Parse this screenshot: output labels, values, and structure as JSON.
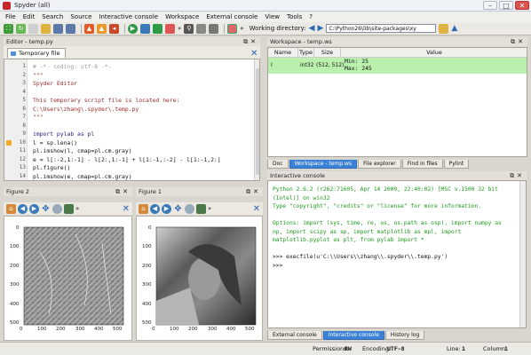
{
  "window": {
    "title": "Spyder (all)",
    "minimize": "–",
    "maximize": "□",
    "close": "✕"
  },
  "menu": [
    "File",
    "Edit",
    "Search",
    "Source",
    "Interactive console",
    "Workspace",
    "External console",
    "View",
    "Tools",
    "?"
  ],
  "toolbar": {
    "working_directory_label": "Working directory:",
    "working_directory_value": "C:\\Python26\\lib\\site-packages\\xy",
    "more": "»"
  },
  "editor": {
    "dock_title": "Editor - temp.py",
    "tab_label": "Temporary file",
    "lines": [
      {
        "n": "1",
        "text": "# -*- coding: utf-8 -*-",
        "color": "#9a9a9a"
      },
      {
        "n": "2",
        "text": "\"\"\"",
        "color": "#9a2a2a"
      },
      {
        "n": "3",
        "text": "Spyder Editor",
        "color": "#9a2a2a"
      },
      {
        "n": "4",
        "text": "",
        "color": "#000000"
      },
      {
        "n": "5",
        "text": "This temporary script file is located here:",
        "color": "#9a2a2a"
      },
      {
        "n": "6",
        "text": "C:\\Users\\zhang\\.spyder\\.temp.py",
        "color": "#9a2a2a"
      },
      {
        "n": "7",
        "text": "\"\"\"",
        "color": "#9a2a2a"
      },
      {
        "n": "8",
        "text": "",
        "color": "#000000"
      },
      {
        "n": "9",
        "text": "import pylab as pl",
        "color": "#1a1a80"
      },
      {
        "n": "10",
        "text": "l = sp.lena()",
        "color": "#111111"
      },
      {
        "n": "11",
        "text": "pl.imshow(l, cmap=pl.cm.gray)",
        "color": "#111111"
      },
      {
        "n": "12",
        "text": "e = l[:-2,1:-1] - l[2:,1:-1] + l[1:-1,:-2] - l[1:-1,2:]",
        "color": "#111111"
      },
      {
        "n": "13",
        "text": "pl.figure()",
        "color": "#111111"
      },
      {
        "n": "14",
        "text": "pl.imshow(e, cmap=pl.cm.gray)",
        "color": "#111111"
      }
    ]
  },
  "workspace": {
    "dock_title": "Workspace - temp.ws",
    "columns": [
      "Name",
      "Type",
      "Size",
      "Value"
    ],
    "rows": [
      {
        "name": "l",
        "type": "int32",
        "size": "(512, 512)",
        "value_line1": "Min: 25",
        "value_line2": "Max: 245"
      }
    ],
    "tabs": [
      "Doc",
      "Workspace - temp.ws",
      "File explorer",
      "Find in files",
      "Pylint"
    ],
    "active_tab": "Workspace - temp.ws"
  },
  "figures": [
    {
      "title": "Figure 2",
      "x_ticks": [
        "0",
        "100",
        "200",
        "300",
        "400",
        "500"
      ],
      "y_ticks": [
        "0",
        "100",
        "200",
        "300",
        "400",
        "500"
      ]
    },
    {
      "title": "Figure 1",
      "x_ticks": [
        "0",
        "100",
        "200",
        "300",
        "400",
        "500"
      ],
      "y_ticks": [
        "0",
        "100",
        "200",
        "300",
        "400",
        "500"
      ]
    }
  ],
  "console": {
    "dock_title": "Interactive console",
    "lines": [
      "Python 2.6.2 (r262:71605, Apr 14 2009, 22:40:02) [MSC v.1500 32 bit",
      "(Intel)] on win32",
      "Type \"copyright\", \"credits\" or \"license\" for more information.",
      "",
      "Options: import (sys, time, re, os, os.path as osp), import numpy as",
      "np, import scipy as sp, import matplotlib as mpl, import",
      "matplotlib.pyplot as plt, from pylab import *",
      "",
      ">>> execfile(u'C:\\\\Users\\\\zhang\\\\.spyder\\\\.temp.py')",
      ">>>"
    ],
    "tabs": [
      "External console",
      "Interactive console",
      "History log"
    ],
    "active_tab": "Interactive console"
  },
  "status": {
    "permissions_label": "Permissions:",
    "permissions_value": "RW",
    "encoding_label": "Encoding:",
    "encoding_value": "UTF-8",
    "line_label": "Line:",
    "line_value": "1",
    "column_label": "Column:",
    "column_value": "1"
  },
  "colors": {
    "accent": "#3b82d6",
    "workspace_row": "#b9f0ad",
    "console_text": "#1a9a1a"
  }
}
